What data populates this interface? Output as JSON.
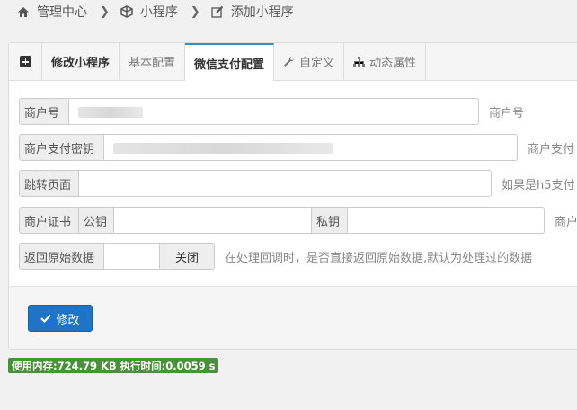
{
  "breadcrumb": {
    "home_icon": "home-icon",
    "home": "管理中心",
    "cube_icon": "cube-icon",
    "mini_program": "小程序",
    "edit_icon": "edit-icon",
    "current": "添加小程序"
  },
  "tabs": [
    {
      "icon": "plus-square-icon",
      "label": ""
    },
    {
      "label": "修改小程序"
    },
    {
      "label": "基本配置"
    },
    {
      "label": "微信支付配置",
      "active": true
    },
    {
      "icon": "wrench-icon",
      "label": "自定义"
    },
    {
      "icon": "sitemap-icon",
      "label": "动态属性"
    }
  ],
  "form": {
    "merchant_id": {
      "label": "商户号",
      "value": "",
      "hint": "商户号"
    },
    "merchant_key": {
      "label": "商户支付密钥",
      "value": "",
      "hint": "商户支付"
    },
    "redirect": {
      "label": "跳转页面",
      "value": "",
      "hint": "如果是h5支付"
    },
    "cert": {
      "label": "商户证书",
      "public_label": "公钥",
      "private_label": "私钥",
      "hint": "商户"
    },
    "raw_data": {
      "label": "返回原始数据",
      "toggle_state": "关闭",
      "hint": "在处理回调时，是否直接返回原始数据,默认为处理过的数据"
    }
  },
  "actions": {
    "modify_label": "修改"
  },
  "status": {
    "memory": "使用内存:724.79 KB 执行时间:0.0059 s"
  },
  "colors": {
    "primary": "#1f74c8",
    "active_tab_border": "#3c8dbc",
    "memory_badge": "#4a8f3c"
  }
}
